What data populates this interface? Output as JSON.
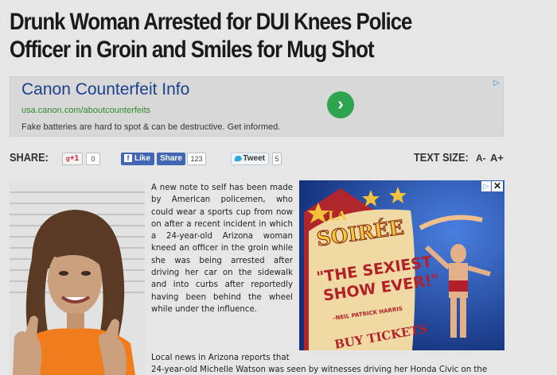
{
  "article": {
    "headline_line1": "Drunk Woman Arrested for DUI Knees Police",
    "headline_line2": "Officer in Groin and Smiles for Mug Shot",
    "para1": "A new note to self has been made by American policemen, who could wear a sports cup from now on after a recent incident in which a 24-year-old Arizona woman kneed an officer in the groin while she was being arrested after driving her car on the sidewalk and into curbs after reportedly having been behind the wheel while under the influence.",
    "para2_line1": "Local news in Arizona reports that",
    "para2_line2": "24-year-old Michelle Watson was seen by witnesses driving her Honda Civic on the"
  },
  "ad_banner": {
    "title": "Canon Counterfeit Info",
    "url": "usa.canon.com/aboutcounterfeits",
    "description": "Fake batteries are hard to spot & can be destructive. Get informed.",
    "go_glyph": "›",
    "adchoice_glyph": "▷"
  },
  "share_bar": {
    "share_label": "SHARE:",
    "gplus_label": "+1",
    "gplus_count": "0",
    "fb_like_label": "Like",
    "fb_share_label": "Share",
    "fb_count": "123",
    "tweet_label": "Tweet",
    "tweet_count": "5",
    "text_size_label": "TEXT SIZE:",
    "decrease_label": "A-",
    "increase_label": "A+"
  },
  "poster_ad": {
    "top_text": "LA",
    "name_text": "SOIRÉE",
    "slogan_line1": "\"THE SEXIEST",
    "slogan_line2": "SHOW EVER!\"",
    "credit": "–NEIL PATRICK HARRIS",
    "cta": "BUY TICKETS",
    "close_glyph": "✕",
    "adchoice_glyph": "▷"
  },
  "colors": {
    "page_bg": "#e6e6e6",
    "ad_title": "#1c3f8c",
    "ad_url": "#2e8b2e",
    "facebook": "#4267b2",
    "poster_bg": "#1f4aa8"
  }
}
